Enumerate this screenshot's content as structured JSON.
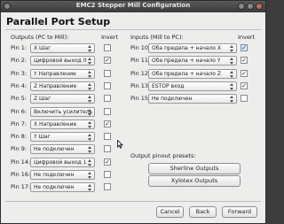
{
  "window": {
    "title": "EMC2 Stepper Mill Configuration"
  },
  "header": "Parallel Port Setup",
  "outputs": {
    "label": "Outputs (PC to Mill):",
    "invert_label": "Invert",
    "pins": [
      {
        "pin": "Pin 1:",
        "value": "X Шаг",
        "invert": false
      },
      {
        "pin": "Pin 2:",
        "value": "Цифровой выход 0",
        "invert": true
      },
      {
        "pin": "Pin 3:",
        "value": "Y Направление",
        "invert": false
      },
      {
        "pin": "Pin 4:",
        "value": "Z Направление",
        "invert": false
      },
      {
        "pin": "Pin 5:",
        "value": "Z Шаг",
        "invert": false
      },
      {
        "pin": "Pin 6:",
        "value": "Включить усилитель",
        "invert": false
      },
      {
        "pin": "Pin 7:",
        "value": "X Направление",
        "invert": true
      },
      {
        "pin": "Pin 8:",
        "value": "Y Шаг",
        "invert": false
      },
      {
        "pin": "Pin 9:",
        "value": "Не подключен",
        "invert": false
      },
      {
        "pin": "Pin 14:",
        "value": "Цифровой выход 1",
        "invert": true
      },
      {
        "pin": "Pin 16:",
        "value": "Не подключен",
        "invert": false
      },
      {
        "pin": "Pin 17:",
        "value": "Не подключен",
        "invert": false
      }
    ]
  },
  "inputs": {
    "label": "Inputs (Mill to PC):",
    "invert_label": "Invert",
    "pins": [
      {
        "pin": "Pin 10:",
        "value": "Оба предела + начало X",
        "invert": true
      },
      {
        "pin": "Pin 11:",
        "value": "Оба предела + начало Y",
        "invert": true
      },
      {
        "pin": "Pin 12:",
        "value": "Оба предела + начало Z",
        "invert": true
      },
      {
        "pin": "Pin 13:",
        "value": "ESTOP вход",
        "invert": true
      },
      {
        "pin": "Pin 15:",
        "value": "Не подключен",
        "invert": false
      }
    ]
  },
  "presets": {
    "label": "Output pinout presets:",
    "sherline": "Sherline Outputs",
    "xylotex": "Xylotex Outputs"
  },
  "buttons": {
    "cancel": "Cancel",
    "back": "Back",
    "forward": "Forward"
  }
}
